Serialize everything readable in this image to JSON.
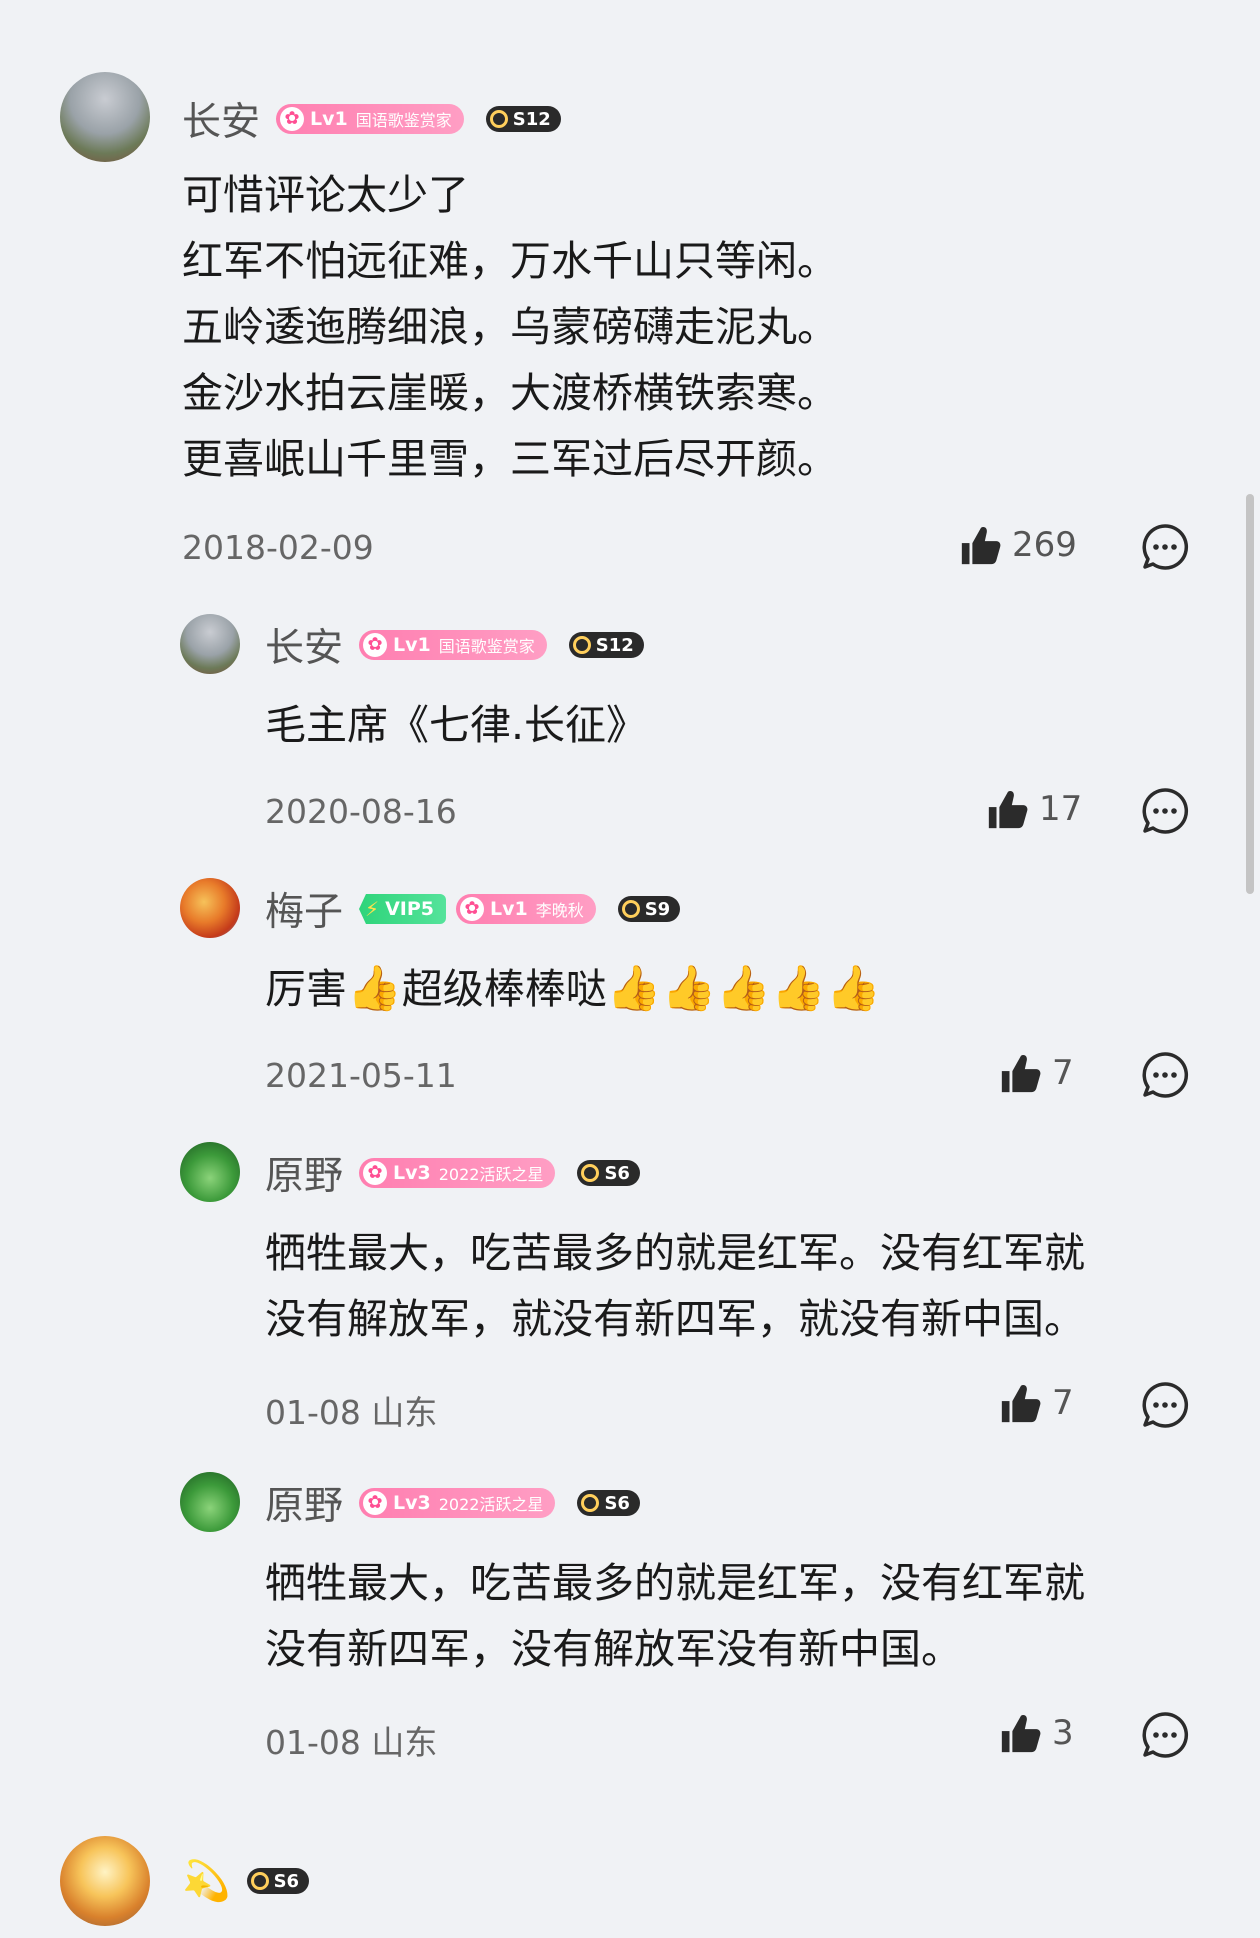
{
  "comments": [
    {
      "username": "长安",
      "level": "Lv1",
      "level_title": "国语歌鉴赏家",
      "season": "S12",
      "lines": [
        "可惜评论太少了",
        "红军不怕远征难，万水千山只等闲。",
        "五岭逶迤腾细浪，乌蒙磅礴走泥丸。",
        "金沙水拍云崖暖，大渡桥横铁索寒。",
        "更喜岷山千里雪，三军过后尽开颜。"
      ],
      "date": "2018-02-09",
      "likes": "269"
    },
    {
      "username": "长安",
      "level": "Lv1",
      "level_title": "国语歌鉴赏家",
      "season": "S12",
      "lines": [
        "毛主席《七律.长征》"
      ],
      "date": "2020-08-16",
      "likes": "17"
    },
    {
      "username": "梅子",
      "vip": "VIP5",
      "level": "Lv1",
      "level_title": "李晚秋",
      "season": "S9",
      "text_prefix": "厉害",
      "text_middle": "超级棒棒哒",
      "emoji": "👍",
      "date": "2021-05-11",
      "likes": "7"
    },
    {
      "username": "原野",
      "level": "Lv3",
      "level_title": "2022活跃之星",
      "season": "S6",
      "lines": [
        "牺牲最大，吃苦最多的就是红军。没有红军就",
        "没有解放军，就没有新四军，就没有新中国。"
      ],
      "date": "01-08 山东",
      "likes": "7"
    },
    {
      "username": "原野",
      "level": "Lv3",
      "level_title": "2022活跃之星",
      "season": "S6",
      "lines": [
        "牺牲最大，吃苦最多的就是红军，没有红军就",
        "没有新四军，没有解放军没有新中国。"
      ],
      "date": "01-08 山东",
      "likes": "3"
    },
    {
      "username": "💫",
      "season": "S6"
    }
  ],
  "icons": [
    "thumbs-up-icon",
    "comment-bubble-icon",
    "coin-icon",
    "flower-icon",
    "bolt-icon"
  ],
  "colors": {
    "background": "#f0f2f5",
    "level_badge": "#ff7eb0",
    "vip_badge": "#2ed47a"
  }
}
